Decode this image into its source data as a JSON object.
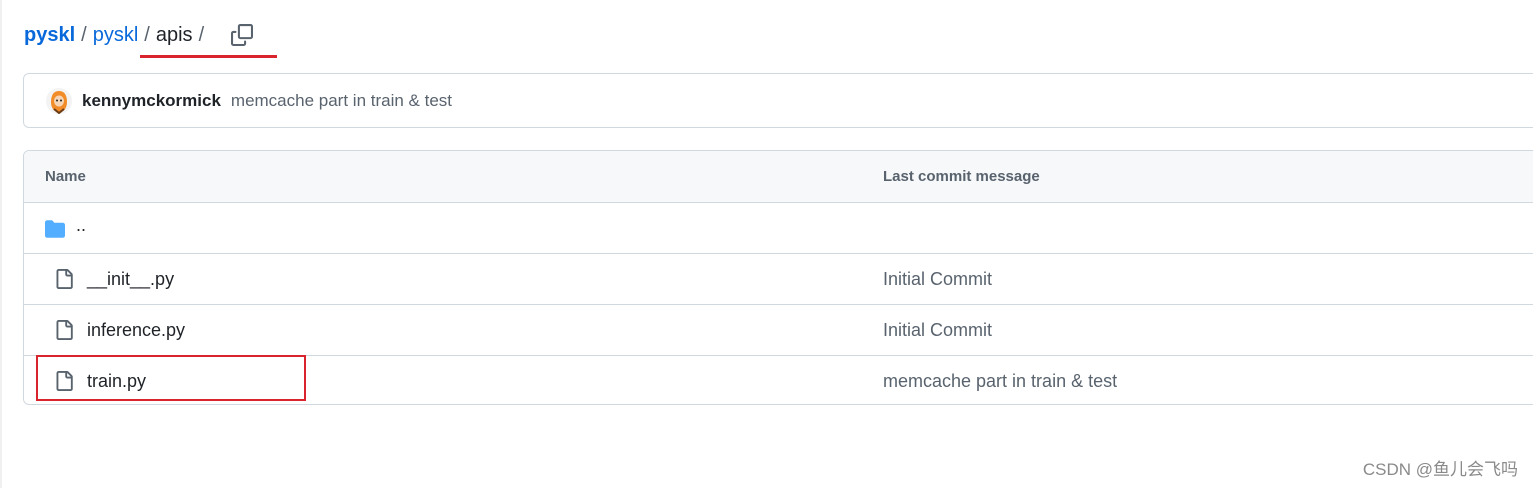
{
  "breadcrumb": {
    "owner": "pyskl",
    "repo": "pyskl",
    "current": "apis",
    "separator": "/"
  },
  "commit": {
    "author": "kennymckormick",
    "message": "memcache part in train & test"
  },
  "table": {
    "headers": {
      "name": "Name",
      "last_commit_message": "Last commit message"
    },
    "parent_dir": "..",
    "rows": [
      {
        "name": "__init__.py",
        "message": "Initial Commit",
        "icon": "file-icon"
      },
      {
        "name": "inference.py",
        "message": "Initial Commit",
        "icon": "file-icon"
      },
      {
        "name": "train.py",
        "message": "memcache part in train & test",
        "icon": "file-icon"
      }
    ]
  },
  "watermark": "CSDN @鱼儿会飞吗",
  "colors": {
    "link": "#0969da",
    "annotation_red": "#d9232d",
    "folder": "#54aeff"
  }
}
